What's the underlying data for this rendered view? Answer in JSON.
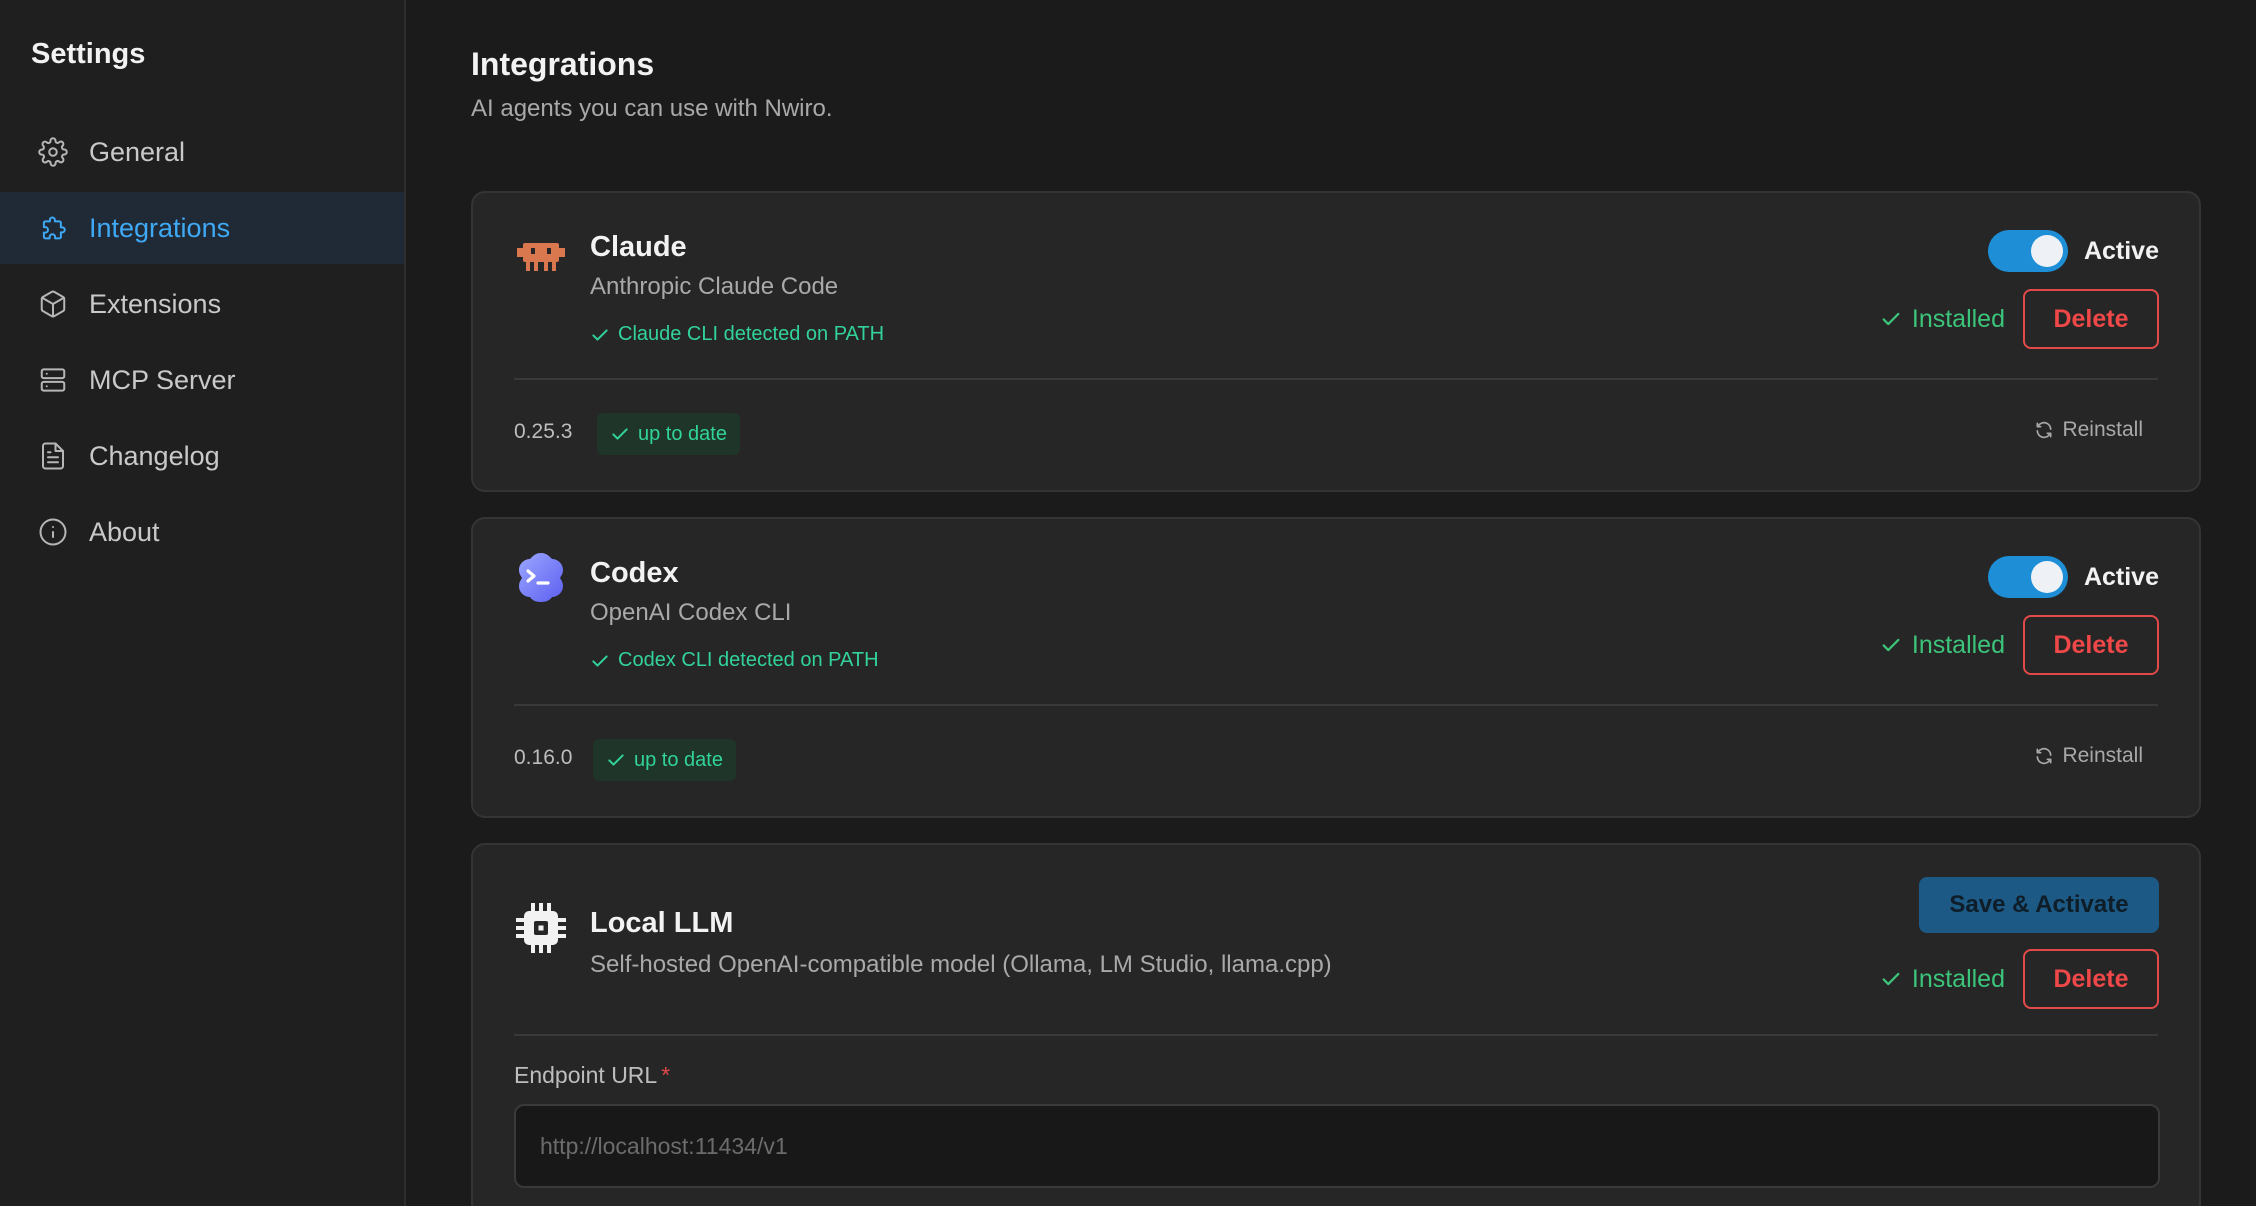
{
  "sidebar": {
    "title": "Settings",
    "items": [
      {
        "label": "General",
        "icon": "gear-icon",
        "active": false
      },
      {
        "label": "Integrations",
        "icon": "puzzle-icon",
        "active": true
      },
      {
        "label": "Extensions",
        "icon": "cube-icon",
        "active": false
      },
      {
        "label": "MCP Server",
        "icon": "server-icon",
        "active": false
      },
      {
        "label": "Changelog",
        "icon": "document-icon",
        "active": false
      },
      {
        "label": "About",
        "icon": "info-icon",
        "active": false
      }
    ]
  },
  "main": {
    "title": "Integrations",
    "subtitle": "AI agents you can use with Nwiro."
  },
  "integrations": [
    {
      "name": "Claude",
      "description": "Anthropic Claude Code",
      "detected": "Claude CLI detected on PATH",
      "toggle_label": "Active",
      "active": true,
      "installed_label": "Installed",
      "delete_label": "Delete",
      "version": "0.25.3",
      "status_label": "up to date",
      "reinstall_label": "Reinstall",
      "icon": "claude-robot-icon"
    },
    {
      "name": "Codex",
      "description": "OpenAI Codex CLI",
      "detected": "Codex CLI detected on PATH",
      "toggle_label": "Active",
      "active": true,
      "installed_label": "Installed",
      "delete_label": "Delete",
      "version": "0.16.0",
      "status_label": "up to date",
      "reinstall_label": "Reinstall",
      "icon": "codex-terminal-icon"
    },
    {
      "name": "Local LLM",
      "description": "Self-hosted OpenAI-compatible model (Ollama, LM Studio, llama.cpp)",
      "save_label": "Save & Activate",
      "installed_label": "Installed",
      "delete_label": "Delete",
      "endpoint_label": "Endpoint URL",
      "endpoint_required_mark": "*",
      "endpoint_value": "",
      "endpoint_placeholder": "http://localhost:11434/v1",
      "icon": "cpu-chip-icon"
    }
  ],
  "colors": {
    "accent": "#3fa9f5",
    "success": "#32d39a",
    "installed": "#3cc57a",
    "danger": "#f04848",
    "toggle_on": "#1e8fd6"
  }
}
